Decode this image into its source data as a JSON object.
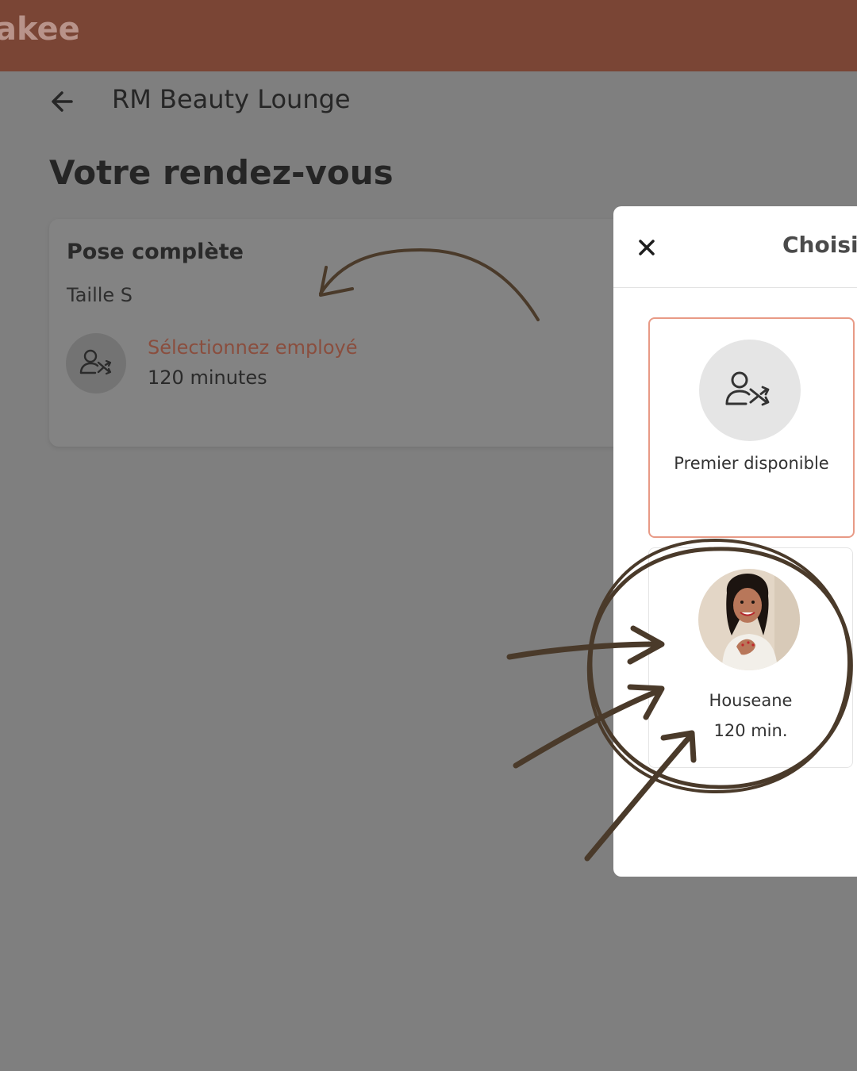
{
  "app": {
    "brand": "akee"
  },
  "header": {
    "salon_name": "RM Beauty Lounge"
  },
  "main": {
    "title": "Votre rendez-vous",
    "service": {
      "name": "Pose complète",
      "size": "Taille S",
      "select_employee": "Sélectionnez employé",
      "duration": "120 minutes"
    }
  },
  "modal": {
    "title": "Choisis",
    "options": [
      {
        "label": "Premier disponible",
        "icon": "random-staff-icon"
      },
      {
        "label": "Houseane",
        "duration": "120 min.",
        "icon": "staff-photo"
      }
    ]
  },
  "colors": {
    "topbar": "#7a4535",
    "accent_border": "#e89a86",
    "select_text": "#8a4e3e",
    "annotation": "#4a3a2a"
  }
}
